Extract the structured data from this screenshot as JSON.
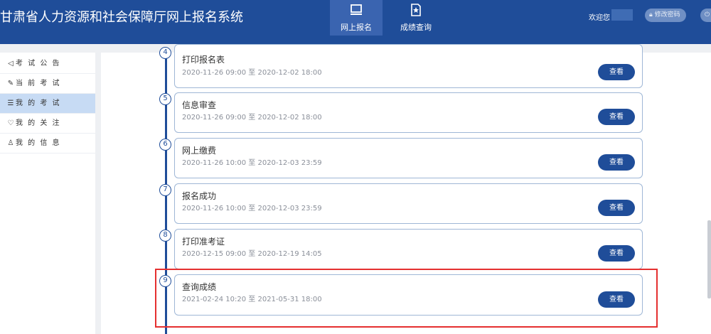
{
  "header": {
    "title": "甘肃省人力资源和社会保障厅网上报名系统",
    "nav": [
      {
        "label": "网上报名",
        "icon": "monitor-icon",
        "active": true
      },
      {
        "label": "成绩查询",
        "icon": "document-star-icon",
        "active": false
      }
    ],
    "welcome": "欢迎您",
    "change_password": "修改密码",
    "logout_partial": "退"
  },
  "sidebar": {
    "items": [
      {
        "label": "考 试 公 告",
        "icon": "speaker-icon",
        "glyph": "◁"
      },
      {
        "label": "当 前 考 试",
        "icon": "edit-icon",
        "glyph": "✎"
      },
      {
        "label": "我 的 考 试",
        "icon": "list-icon",
        "glyph": "☰",
        "active": true
      },
      {
        "label": "我 的 关 注",
        "icon": "heart-icon",
        "glyph": "♡"
      },
      {
        "label": "我 的 信 息",
        "icon": "user-icon",
        "glyph": "♙"
      }
    ]
  },
  "steps": [
    {
      "num": "4",
      "title": "打印报名表",
      "date": "2020-11-26 09:00 至 2020-12-02 18:00",
      "button": "查看"
    },
    {
      "num": "5",
      "title": "信息审查",
      "date": "2020-11-26 09:00 至 2020-12-02 18:00",
      "button": "查看"
    },
    {
      "num": "6",
      "title": "网上缴费",
      "date": "2020-11-26 10:00 至 2020-12-03 23:59",
      "button": "查看"
    },
    {
      "num": "7",
      "title": "报名成功",
      "date": "2020-11-26 10:00 至 2020-12-03 23:59",
      "button": "查看"
    },
    {
      "num": "8",
      "title": "打印准考证",
      "date": "2020-12-15 09:00 至 2020-12-19 14:05",
      "button": "查看"
    },
    {
      "num": "9",
      "title": "查询成绩",
      "date": "2021-02-24 10:20 至 2021-05-31 18:00",
      "button": "查看"
    }
  ],
  "colors": {
    "brand": "#1f4d99",
    "highlight": "#e53030",
    "active_side": "#c7dbf4"
  }
}
